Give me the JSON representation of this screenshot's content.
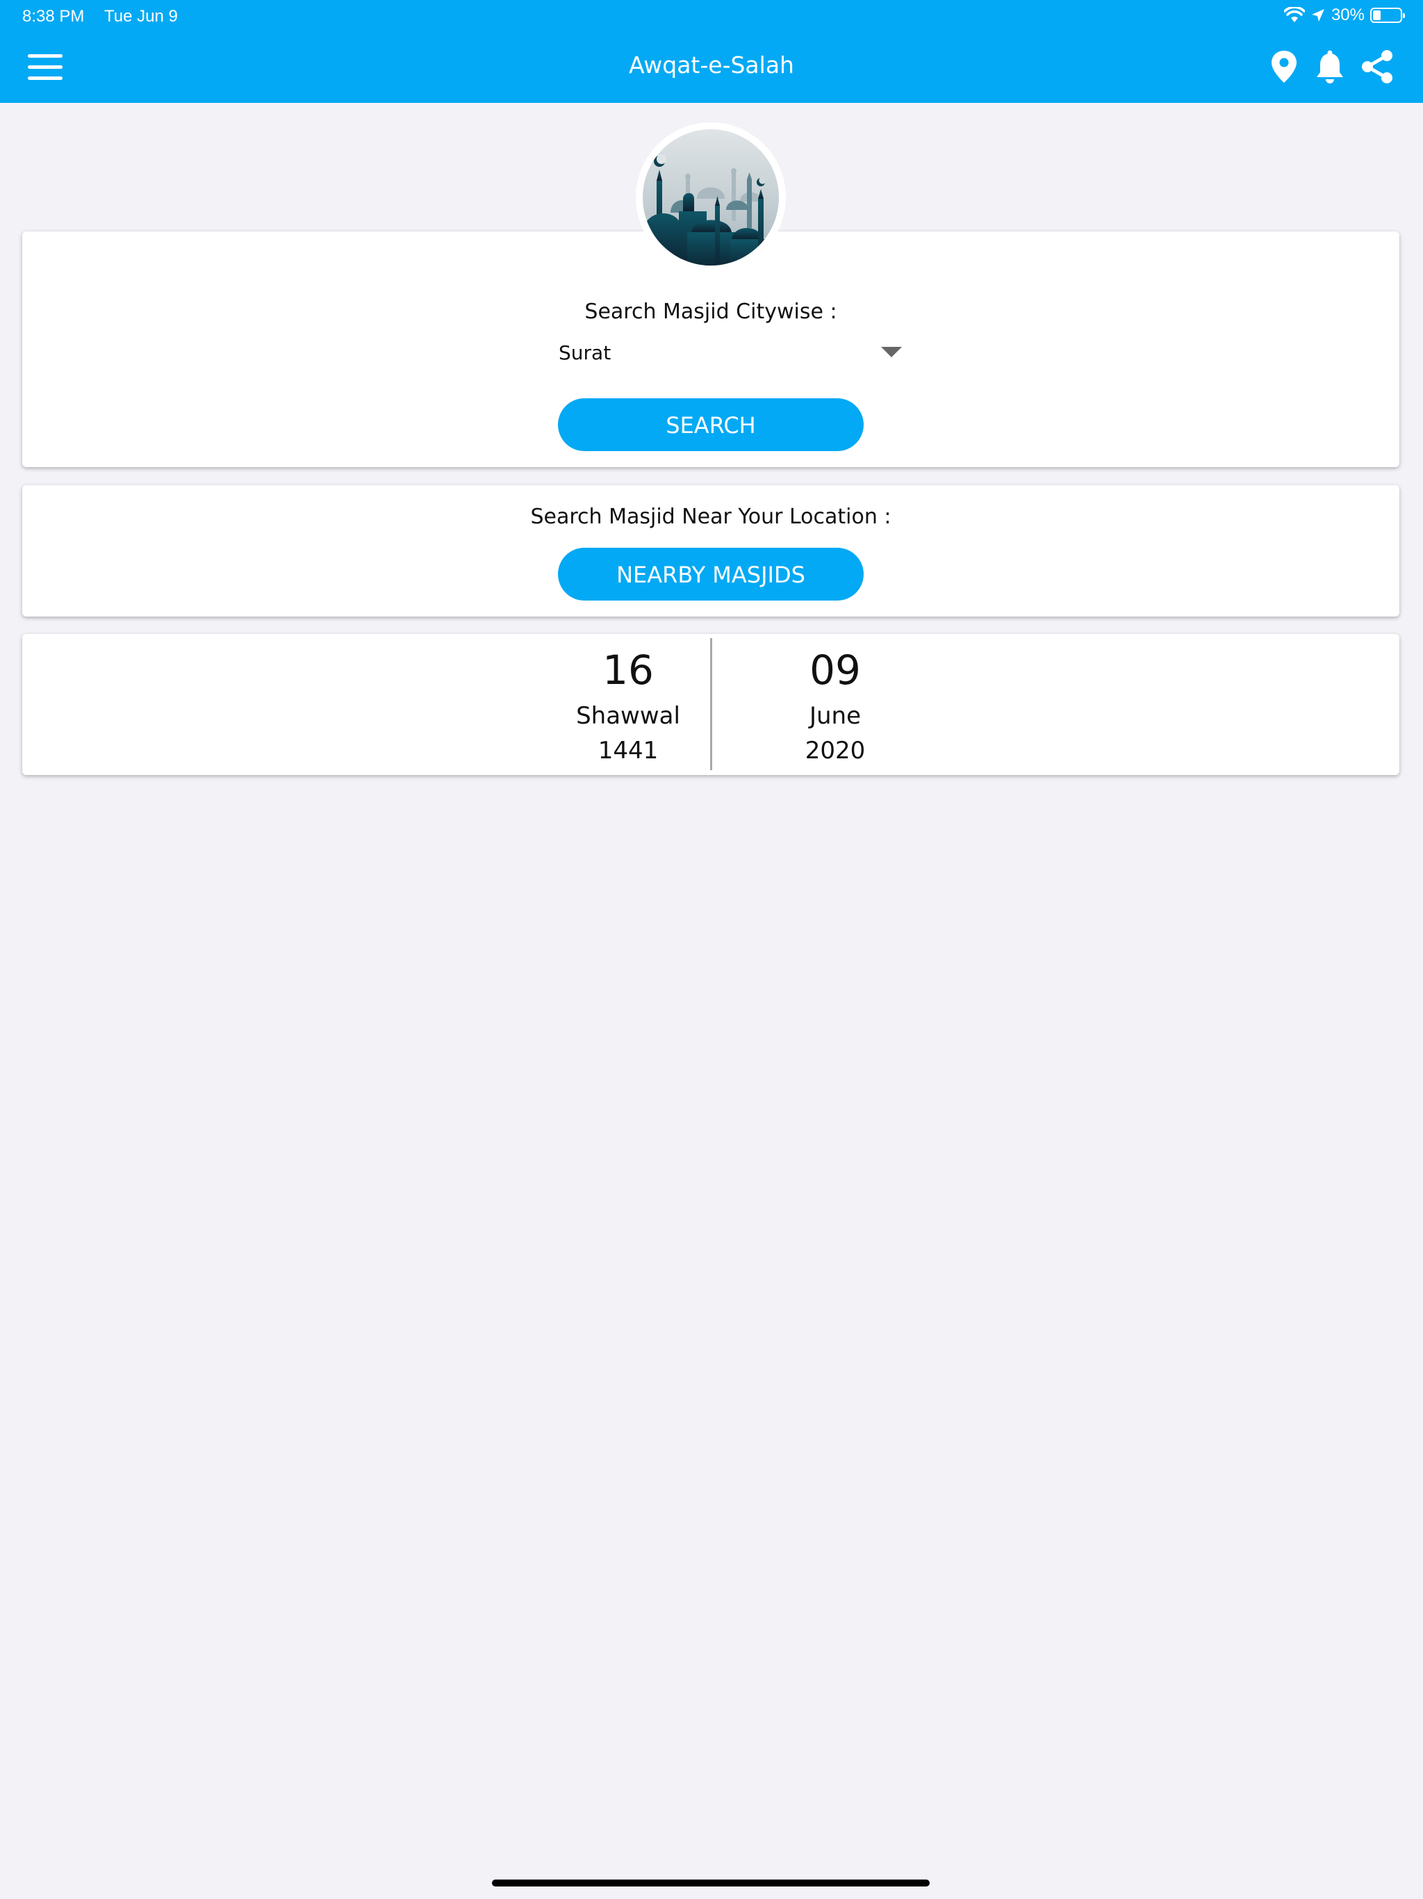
{
  "status_bar": {
    "time": "8:38 PM",
    "date": "Tue Jun 9",
    "battery": "30%",
    "battery_level": 0.3
  },
  "header": {
    "title": "Awqat-e-Salah",
    "icons": [
      "menu-icon",
      "location-pin-icon",
      "bell-icon",
      "share-icon"
    ]
  },
  "city_search": {
    "label": "Search Masjid Citywise :",
    "selected_city": "Surat",
    "button_label": "SEARCH"
  },
  "nearby_search": {
    "label": "Search Masjid Near Your Location :",
    "button_label": "NEARBY MASJIDS"
  },
  "date": {
    "hijri": {
      "day": "16",
      "month": "Shawwal",
      "year": "1441"
    },
    "gregorian": {
      "day": "09",
      "month": "June",
      "year": "2020"
    }
  },
  "colors": {
    "accent": "#03a9f4",
    "background": "#f2f2f7",
    "card": "#ffffff"
  }
}
